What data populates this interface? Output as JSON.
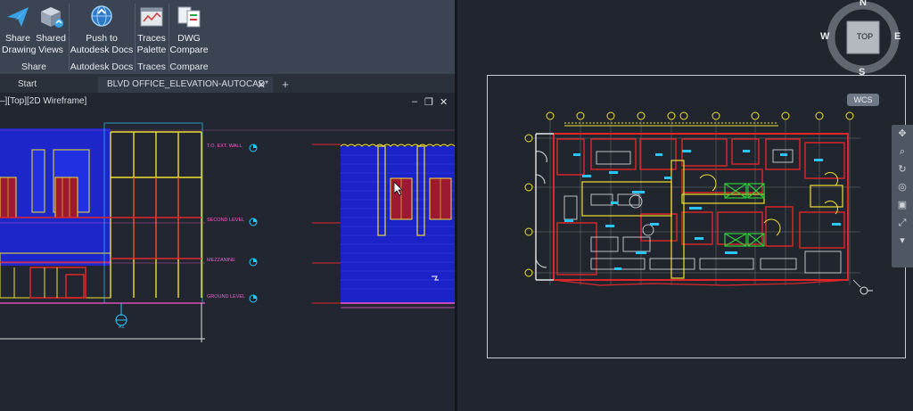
{
  "ribbon": {
    "share": {
      "title": "Share",
      "share_drawing": "Share\nDrawing",
      "shared_views": "Shared\nViews"
    },
    "autodesk_docs": {
      "title": "Autodesk Docs",
      "push": "Push to\nAutodesk Docs"
    },
    "traces": {
      "title": "Traces",
      "palette": "Traces\nPalette"
    },
    "compare": {
      "title": "Compare",
      "dwg_compare": "DWG\nCompare"
    }
  },
  "tabs": {
    "start": "Start",
    "document": "BLVD OFFICE_ELEVATION-AUTOCAD*",
    "close": "✕",
    "add": "+"
  },
  "viewport": {
    "label": "–][Top][2D Wireframe]",
    "minimize": "–",
    "restore": "❐",
    "close": "✕"
  },
  "elevation_levels": [
    "T.O. EXT. WALL",
    "SECOND LEVEL",
    "MEZZANINE",
    "GROUND LEVEL"
  ],
  "viewcube": {
    "n": "N",
    "s": "S",
    "e": "E",
    "w": "W",
    "face": "TOP"
  },
  "wcs": "WCS",
  "colors": {
    "ribbon_bg": "#3b4453",
    "viewport_bg": "#212630",
    "cad_blue": "#1b22c8",
    "cad_red": "#e0262a",
    "cad_yellow": "#f0e030",
    "cad_cyan": "#2bc6ff",
    "cad_pink": "#ff5ad0"
  }
}
